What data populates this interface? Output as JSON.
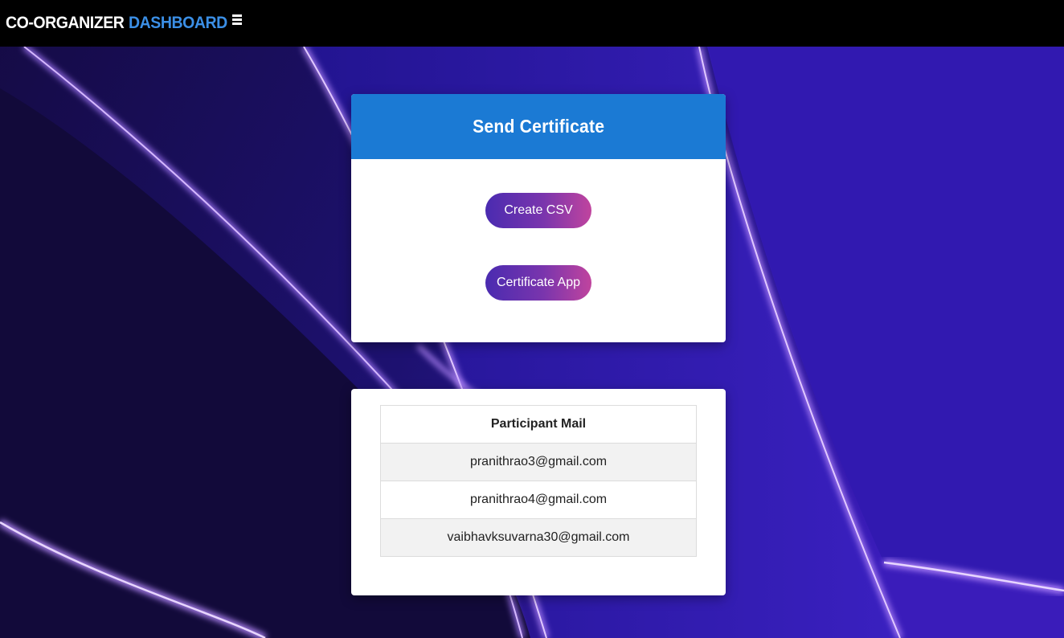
{
  "navbar": {
    "brand_main": "CO-ORGANIZER",
    "brand_accent": "DASHBOARD",
    "menu_icon": "hamburger-menu-icon"
  },
  "send_card": {
    "title": "Send Certificate",
    "buttons": {
      "create_csv": "Create CSV",
      "certificate_app": "Certificate App"
    }
  },
  "participants_table": {
    "header": "Participant Mail",
    "rows": [
      "pranithrao3@gmail.com",
      "pranithrao4@gmail.com",
      "vaibhavksuvarna30@gmail.com"
    ]
  },
  "colors": {
    "navbar_bg": "#000000",
    "brand_accent": "#3b8fe6",
    "card_header": "#1b7ad4",
    "button_gradient_start": "#4a2bb0",
    "button_gradient_end": "#c0449e",
    "background_dark": "#140c4a",
    "background_light": "#3a1cb8"
  }
}
